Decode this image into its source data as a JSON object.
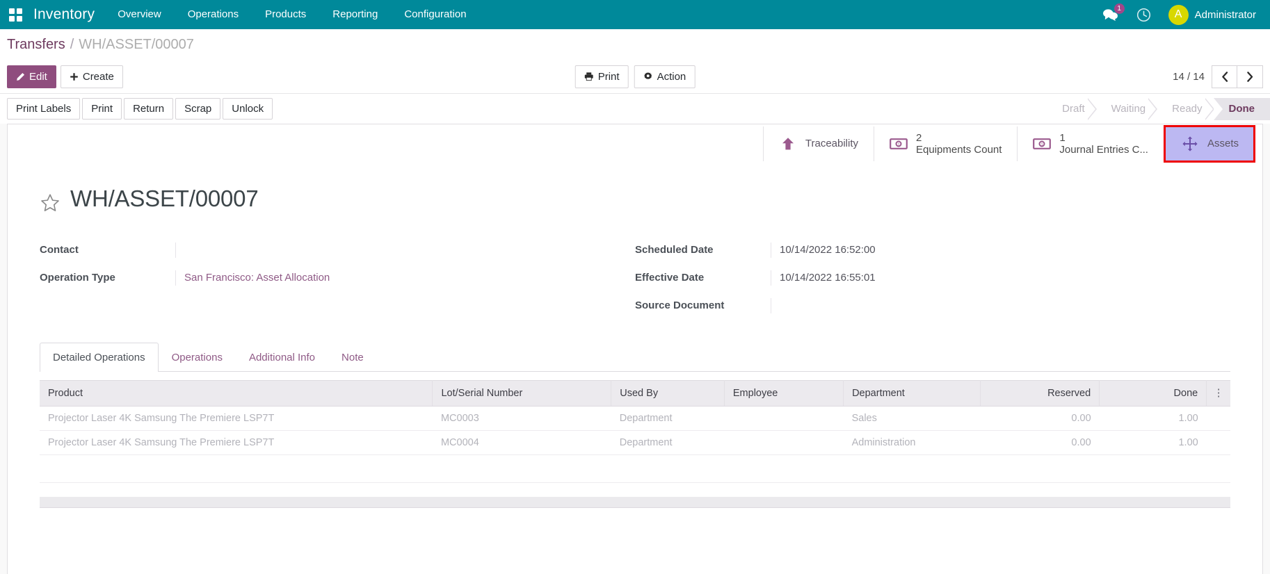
{
  "navbar": {
    "apps_icon": "apps-grid-icon",
    "brand": "Inventory",
    "menu": [
      {
        "label": "Overview"
      },
      {
        "label": "Operations"
      },
      {
        "label": "Products"
      },
      {
        "label": "Reporting"
      },
      {
        "label": "Configuration"
      }
    ],
    "messages_icon": "chat-bubble-icon",
    "messages_count": "1",
    "activities_icon": "clock-icon",
    "user_initial": "A",
    "user_name": "Administrator",
    "background_color": "#00899a",
    "avatar_color": "#d8d800",
    "badge_color": "#a24689"
  },
  "breadcrumb": {
    "parent": "Transfers",
    "separator": "/",
    "current": "WH/ASSET/00007"
  },
  "control_panel": {
    "edit_label": "Edit",
    "edit_icon": "pencil-icon",
    "create_label": "Create",
    "create_icon": "plus-icon",
    "print_label": "Print",
    "print_icon": "printer-icon",
    "action_label": "Action",
    "action_icon": "gear-icon",
    "pager_value": "14 / 14",
    "prev_icon": "chevron-left-icon",
    "next_icon": "chevron-right-icon"
  },
  "statusbar": {
    "buttons": [
      {
        "label": "Print Labels"
      },
      {
        "label": "Print"
      },
      {
        "label": "Return"
      },
      {
        "label": "Scrap"
      },
      {
        "label": "Unlock"
      }
    ],
    "stages": [
      {
        "label": "Draft",
        "active": false
      },
      {
        "label": "Waiting",
        "active": false
      },
      {
        "label": "Ready",
        "active": false
      },
      {
        "label": "Done",
        "active": true
      }
    ],
    "active_color": "#6e3b5f"
  },
  "smart_buttons": [
    {
      "value": "",
      "label": "Traceability",
      "icon": "arrow-up-icon",
      "highlighted": false
    },
    {
      "value": "2",
      "label": "Equipments Count",
      "icon": "money-bill-icon",
      "highlighted": false
    },
    {
      "value": "1",
      "label": "Journal Entries C...",
      "icon": "money-bill-icon",
      "highlighted": false
    },
    {
      "value": "",
      "label": "Assets",
      "icon": "arrows-move-icon",
      "highlighted": true
    }
  ],
  "highlight": {
    "border_color": "#ee0000",
    "fill_color": "#bcb8f2"
  },
  "record": {
    "star_icon": "star-outline-icon",
    "title": "WH/ASSET/00007"
  },
  "form": {
    "left": [
      {
        "label": "Contact",
        "value": "",
        "is_link": false
      },
      {
        "label": "Operation Type",
        "value": "San Francisco: Asset Allocation",
        "is_link": true
      }
    ],
    "right": [
      {
        "label": "Scheduled Date",
        "value": "10/14/2022 16:52:00",
        "is_link": false
      },
      {
        "label": "Effective Date",
        "value": "10/14/2022 16:55:01",
        "is_link": false
      },
      {
        "label": "Source Document",
        "value": "",
        "is_link": false
      }
    ]
  },
  "notebook": {
    "tabs": [
      {
        "label": "Detailed Operations",
        "active": true
      },
      {
        "label": "Operations",
        "active": false
      },
      {
        "label": "Additional Info",
        "active": false
      },
      {
        "label": "Note",
        "active": false
      }
    ]
  },
  "table": {
    "columns": [
      {
        "label": "Product",
        "align": "left"
      },
      {
        "label": "Lot/Serial Number",
        "align": "left"
      },
      {
        "label": "Used By",
        "align": "left"
      },
      {
        "label": "Employee",
        "align": "left"
      },
      {
        "label": "Department",
        "align": "left"
      },
      {
        "label": "Reserved",
        "align": "right"
      },
      {
        "label": "Done",
        "align": "right"
      }
    ],
    "optional_columns_icon": "vertical-dots-icon",
    "rows": [
      {
        "product": "Projector Laser 4K Samsung The Premiere LSP7T",
        "lot_serial": "MC0003",
        "used_by": "Department",
        "employee": "",
        "department": "Sales",
        "reserved": "0.00",
        "done": "1.00"
      },
      {
        "product": "Projector Laser 4K Samsung The Premiere LSP7T",
        "lot_serial": "MC0004",
        "used_by": "Department",
        "employee": "",
        "department": "Administration",
        "reserved": "0.00",
        "done": "1.00"
      }
    ]
  }
}
